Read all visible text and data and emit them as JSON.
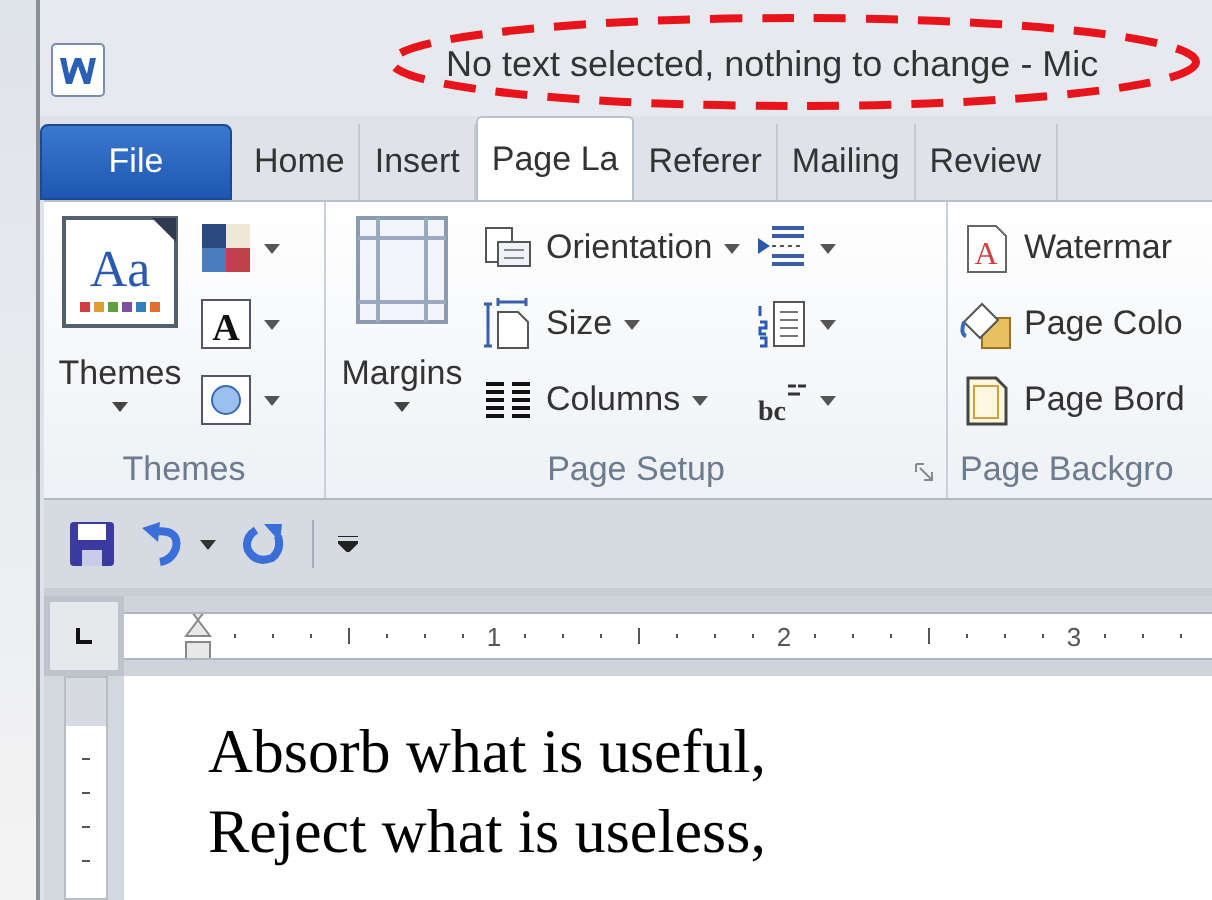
{
  "title": "No text selected, nothing to change  -  Mic",
  "tabs": [
    {
      "label": "File",
      "kind": "file",
      "selected": false
    },
    {
      "label": "Home",
      "kind": "tab",
      "selected": false
    },
    {
      "label": "Insert",
      "kind": "tab",
      "selected": false
    },
    {
      "label": "Page La",
      "kind": "tab",
      "selected": true
    },
    {
      "label": "Referer",
      "kind": "tab",
      "selected": false
    },
    {
      "label": "Mailing",
      "kind": "tab",
      "selected": false
    },
    {
      "label": "Review",
      "kind": "tab",
      "selected": false
    }
  ],
  "ribbon_groups": [
    {
      "label": "Themes",
      "launcher": false,
      "large": {
        "kind": "themes",
        "label": "Themes",
        "icon_text": "Aa",
        "dropdown": true
      },
      "columns": [
        [
          {
            "kind": "colors",
            "dropdown": true
          },
          {
            "kind": "fonts",
            "icon_text": "A",
            "dropdown": true
          },
          {
            "kind": "effects",
            "dropdown": true
          }
        ]
      ]
    },
    {
      "label": "Page Setup",
      "launcher": true,
      "large": {
        "kind": "margins",
        "label": "Margins",
        "dropdown": true
      },
      "columns": [
        [
          {
            "kind": "orientation",
            "label": "Orientation",
            "dropdown": true
          },
          {
            "kind": "size",
            "label": "Size",
            "dropdown": true
          },
          {
            "kind": "columns",
            "label": "Columns",
            "dropdown": true
          }
        ],
        [
          {
            "kind": "breaks",
            "dropdown": true
          },
          {
            "kind": "numbers",
            "dropdown": true
          },
          {
            "kind": "hyphenation",
            "icon_text": "bc",
            "dropdown": true
          }
        ]
      ]
    },
    {
      "label": "Page Backgro",
      "launcher": false,
      "columns": [
        [
          {
            "kind": "watermark",
            "label": "Watermar",
            "icon_text": "A",
            "dropdown": false
          },
          {
            "kind": "pagecolor",
            "label": "Page Colo",
            "dropdown": false
          },
          {
            "kind": "borders",
            "label": "Page Bord",
            "dropdown": false
          }
        ]
      ]
    }
  ],
  "ruler": {
    "numbers": [
      "1",
      "2",
      "3"
    ]
  },
  "document": {
    "lines": [
      "Absorb what is useful,",
      "Reject what is useless,"
    ]
  }
}
